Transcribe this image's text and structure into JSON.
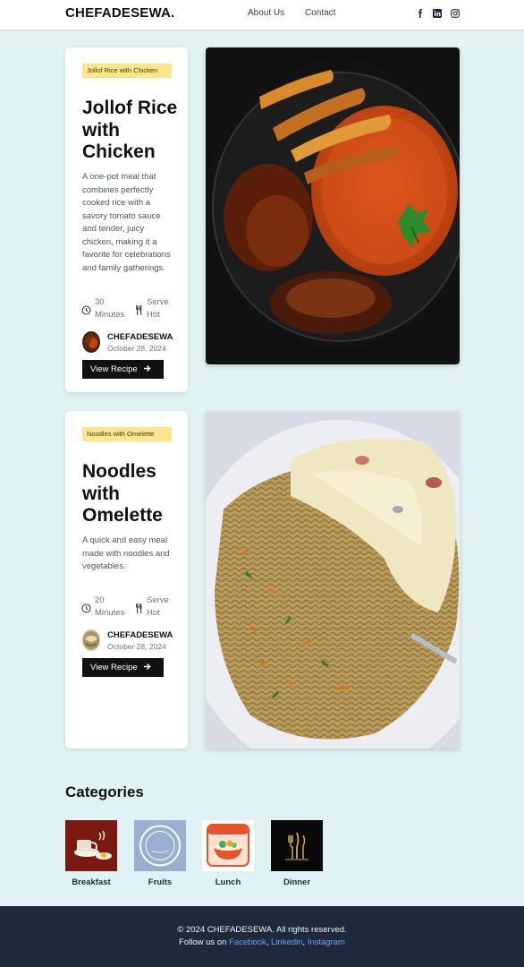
{
  "header": {
    "brand": "CHEFADESEWA.",
    "nav": [
      {
        "label": "About Us"
      },
      {
        "label": "Contact"
      }
    ],
    "social_icons": [
      "facebook-icon",
      "linkedin-icon",
      "instagram-icon"
    ]
  },
  "recipes": [
    {
      "tag": "Jollof Rice with Chicken",
      "title": "Jollof Rice with Chicken",
      "description": "A one-pot meal that combines perfectly cooked rice with a savory tomato sauce and tender, juicy chicken, making it a favorite for celebrations and family gatherings.",
      "time": "30 Minutes",
      "serve": "Serve Hot",
      "author": "CHEFADESEWA",
      "date": "October 28, 2024",
      "button": "View Recipe"
    },
    {
      "tag": "Noodles with Omelette",
      "title": "Noodles with Omelette",
      "description": "A quick and easy meal made with noodles and vegetables.",
      "time": "20 Minutes",
      "serve": "Serve Hot",
      "author": "CHEFADESEWA",
      "date": "October 28, 2024",
      "button": "View Recipe"
    }
  ],
  "categories": {
    "heading": "Categories",
    "items": [
      {
        "label": "Breakfast",
        "icon": "breakfast-icon"
      },
      {
        "label": "Fruits",
        "icon": "plate-icon"
      },
      {
        "label": "Lunch",
        "icon": "lunch-bowl-icon"
      },
      {
        "label": "Dinner",
        "icon": "dinner-cutlery-icon"
      }
    ]
  },
  "footer": {
    "copyright": "© 2024 CHEFADESEWA. All rights reserved.",
    "follow_prefix": "Follow us on ",
    "links": [
      "Facebook",
      "Linkedin",
      "Instagram"
    ],
    "separator": ", "
  },
  "colors": {
    "background": "#e0f2f3",
    "tag": "#fde68a",
    "button": "#111111",
    "footer": "#1e293b",
    "link": "#60a5fa"
  }
}
